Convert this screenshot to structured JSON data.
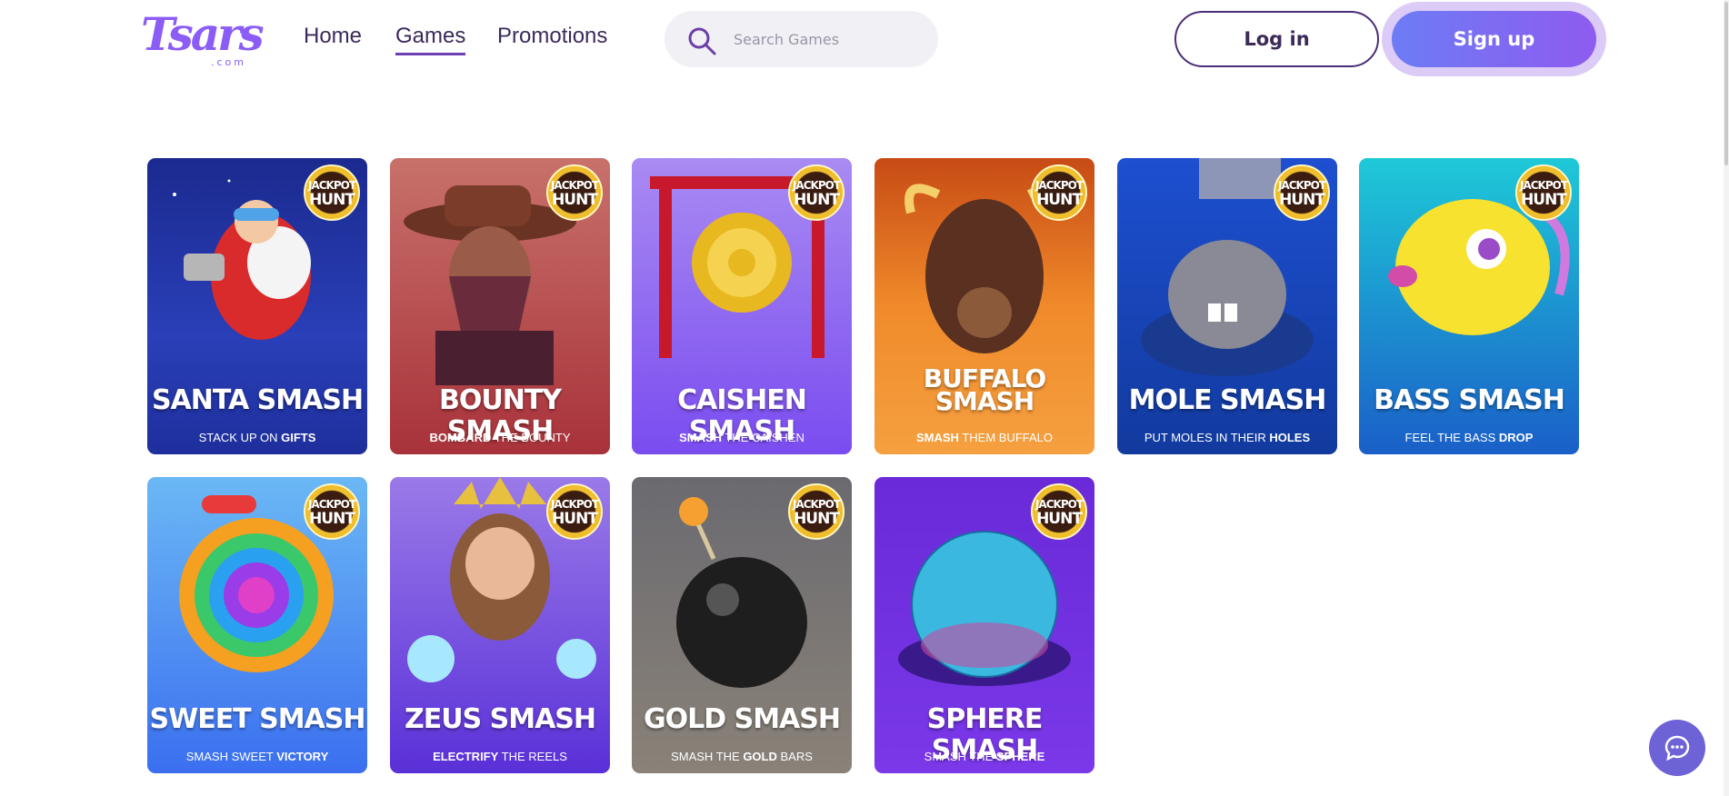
{
  "header": {
    "logo_text": "Tsars",
    "logo_sub": ".com",
    "nav": [
      {
        "label": "Home",
        "active": false
      },
      {
        "label": "Games",
        "active": true
      },
      {
        "label": "Promotions",
        "active": false
      }
    ],
    "search_placeholder": "Search Games",
    "login_label": "Log in",
    "signup_label": "Sign up"
  },
  "badge": {
    "line1": "JACKPOT",
    "line2": "HUNT"
  },
  "games": [
    {
      "title": "SANTA SMASH",
      "sub_pre": "STACK UP ON ",
      "sub_bold": "GIFTS",
      "sub_post": ""
    },
    {
      "title": "BOUNTY SMASH",
      "sub_pre": "",
      "sub_bold": "BOMBARD",
      "sub_post": " THE BOUNTY"
    },
    {
      "title": "CAISHEN SMASH",
      "sub_pre": "",
      "sub_bold": "SMASH",
      "sub_post": " THE CAISHEN"
    },
    {
      "title": "BUFFALO SMASH",
      "sub_pre": "",
      "sub_bold": "SMASH",
      "sub_post": " THEM BUFFALO"
    },
    {
      "title": "MOLE SMASH",
      "sub_pre": "PUT MOLES IN THEIR ",
      "sub_bold": "HOLES",
      "sub_post": ""
    },
    {
      "title": "BASS SMASH",
      "sub_pre": "FEEL THE BASS ",
      "sub_bold": "DROP",
      "sub_post": ""
    },
    {
      "title": "SWEET SMASH",
      "sub_pre": "SMASH SWEET ",
      "sub_bold": "VICTORY",
      "sub_post": ""
    },
    {
      "title": "ZEUS SMASH",
      "sub_pre": "",
      "sub_bold": "ELECTRIFY",
      "sub_post": " THE REELS"
    },
    {
      "title": "GOLD SMASH",
      "sub_pre": "SMASH THE ",
      "sub_bold": "GOLD",
      "sub_post": " BARS"
    },
    {
      "title": "SPHERE SMASH",
      "sub_pre": "SMASH THE ",
      "sub_bold": "SPHERE",
      "sub_post": ""
    }
  ],
  "colors": {
    "accent": "#6d3fb0",
    "signup_start": "#6d7cf5",
    "signup_end": "#8e5bf0",
    "chat": "#6d63d6"
  },
  "icons": {
    "search": "search-icon",
    "chat": "chat-bubble-icon"
  }
}
